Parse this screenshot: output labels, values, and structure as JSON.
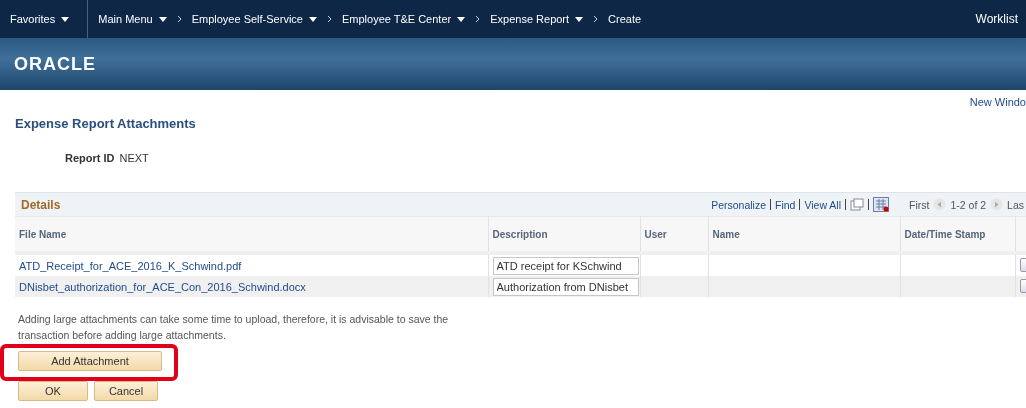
{
  "nav": {
    "items": [
      {
        "label": "Favorites",
        "kind": "menu"
      },
      {
        "label": "Main Menu",
        "kind": "menu"
      },
      {
        "label": "Employee Self-Service",
        "kind": "crumb-menu"
      },
      {
        "label": "Employee T&E Center",
        "kind": "crumb-menu"
      },
      {
        "label": "Expense Report",
        "kind": "crumb-menu"
      },
      {
        "label": "Create",
        "kind": "crumb"
      }
    ],
    "right": "Worklist"
  },
  "brand": "ORACLE",
  "new_window": "New Windo",
  "page_title": "Expense Report Attachments",
  "report_id": {
    "label": "Report ID",
    "value": "NEXT"
  },
  "grid": {
    "title": "Details",
    "links": [
      "Personalize",
      "Find",
      "View All"
    ],
    "first": "First",
    "range": "1-2 of 2",
    "last": "Las",
    "columns": [
      "File Name",
      "Description",
      "User",
      "Name",
      "Date/Time Stamp"
    ],
    "rows": [
      {
        "file": "ATD_Receipt_for_ACE_2016_K_Schwind.pdf",
        "description": "ATD receipt for KSchwind"
      },
      {
        "file": "DNisbet_authorization_for_ACE_Con_2016_Schwind.docx",
        "description": "Authorization from DNisbet"
      }
    ]
  },
  "help_text": "Adding large attachments can take some time to upload, therefore, it is advisable to save the transaction before adding large attachments.",
  "add_button": {
    "label": "Add Attachment",
    "highlighted": true
  },
  "buttons": [
    "OK",
    "Cancel"
  ]
}
